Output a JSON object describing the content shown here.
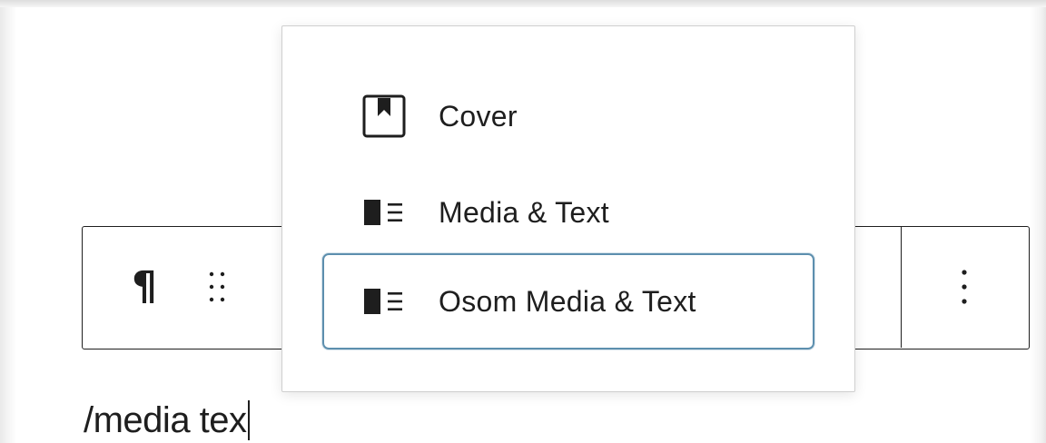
{
  "editor": {
    "typed_text": "/media tex"
  },
  "toolbar": {
    "items": [
      {
        "name": "paragraph",
        "icon": "paragraph-icon",
        "glyph": "¶"
      },
      {
        "name": "drag-handle",
        "icon": "drag-handle-icon"
      },
      {
        "name": "more-options",
        "icon": "vertical-ellipsis-icon"
      }
    ]
  },
  "popover": {
    "options": [
      {
        "label": "Cover",
        "icon": "cover-icon",
        "selected": false
      },
      {
        "label": "Media & Text",
        "icon": "media-text-icon",
        "selected": false
      },
      {
        "label": "Osom Media & Text",
        "icon": "media-text-icon",
        "selected": true
      }
    ]
  },
  "colors": {
    "text": "#1e1e1e",
    "selected_border": "#5d8fae",
    "popover_border": "#cfcfcf"
  }
}
